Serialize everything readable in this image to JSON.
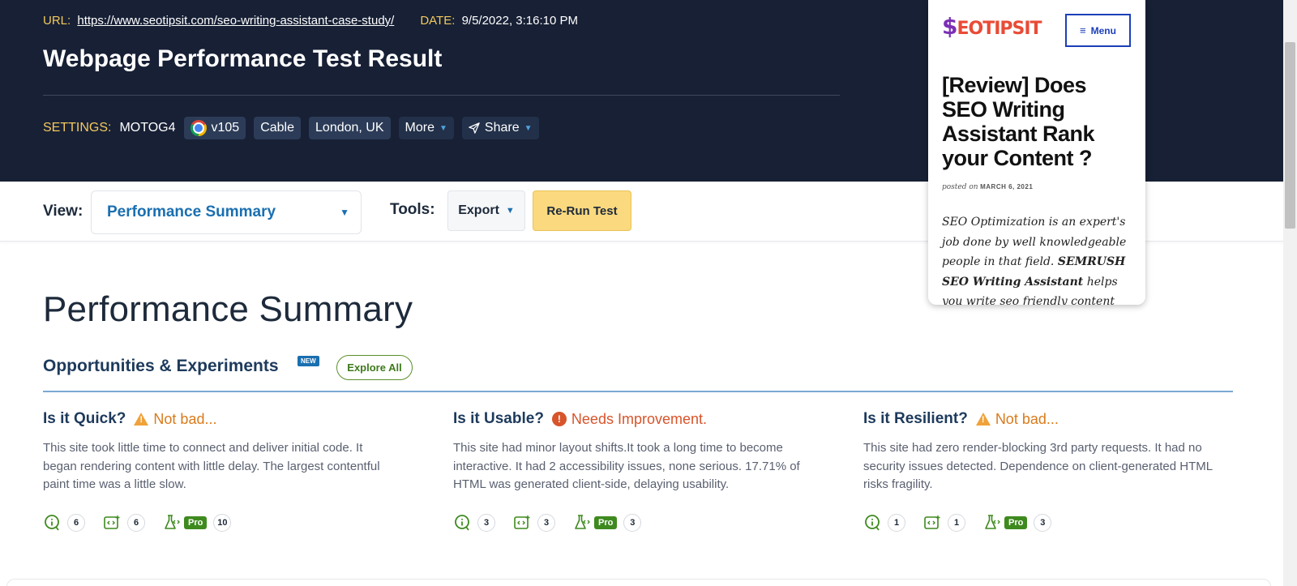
{
  "header": {
    "url_label": "URL:",
    "url": "https://www.seotipsit.com/seo-writing-assistant-case-study/",
    "date_label": "DATE:",
    "date": "9/5/2022, 3:16:10 PM",
    "title": "Webpage Performance Test Result",
    "settings_label": "SETTINGS:",
    "device": "MOTOG4",
    "browser": "v105",
    "connection": "Cable",
    "location": "London, UK",
    "more": "More",
    "share": "Share"
  },
  "toolbar": {
    "view_label": "View:",
    "view_value": "Performance Summary",
    "tools_label": "Tools:",
    "export": "Export",
    "rerun": "Re-Run Test"
  },
  "summary": {
    "title": "Performance Summary",
    "opp_title": "Opportunities & Experiments",
    "new_badge": "NEW",
    "explore": "Explore All",
    "columns": [
      {
        "question": "Is it Quick?",
        "status": "Not bad...",
        "description": "This site took little time to connect and deliver initial code. It began rendering content with little delay. The largest contentful paint time was a little slow.",
        "tips": "6",
        "code": "6",
        "pro": "Pro",
        "experiments": "10"
      },
      {
        "question": "Is it Usable?",
        "status": "Needs Improvement.",
        "description": "This site had minor layout shifts.It took a long time to become interactive. It had 2 accessibility issues, none serious. 17.71% of HTML was generated client-side, delaying usability.",
        "tips": "3",
        "code": "3",
        "pro": "Pro",
        "experiments": "3"
      },
      {
        "question": "Is it Resilient?",
        "status": "Not bad...",
        "description": "This site had zero render-blocking 3rd party requests. It had no security issues detected. Dependence on client-generated HTML risks fragility.",
        "tips": "1",
        "code": "1",
        "pro": "Pro",
        "experiments": "3"
      }
    ]
  },
  "preview": {
    "logo_s": "$",
    "logo_rest": "EOTIPSIT",
    "menu": "Menu",
    "title": "[Review] Does SEO Writing Assistant Rank your Content ?",
    "posted_on": "posted on",
    "posted_date": "MARCH 6, 2021",
    "text_1": "SEO Optimization is an expert's job done by well knowledgeable people in that field. ",
    "text_bold": "SEMRUSH SEO Writing Assistant",
    "text_2": " helps you write seo friendly content"
  },
  "colors": {
    "header_bg": "#172035",
    "accent_yellow": "#f4c95d",
    "link_blue": "#1a6fb0",
    "rerun_bg": "#fbd97f",
    "pro_green": "#3e8a1f",
    "warn_orange": "#d97a1a",
    "bad_red": "#d8542a"
  },
  "icons": [
    "chrome-icon",
    "caret-down-icon",
    "send-icon",
    "info-circle-icon",
    "code-window-icon",
    "beaker-code-icon",
    "warning-triangle-icon",
    "alert-circle-icon",
    "hamburger-icon"
  ]
}
